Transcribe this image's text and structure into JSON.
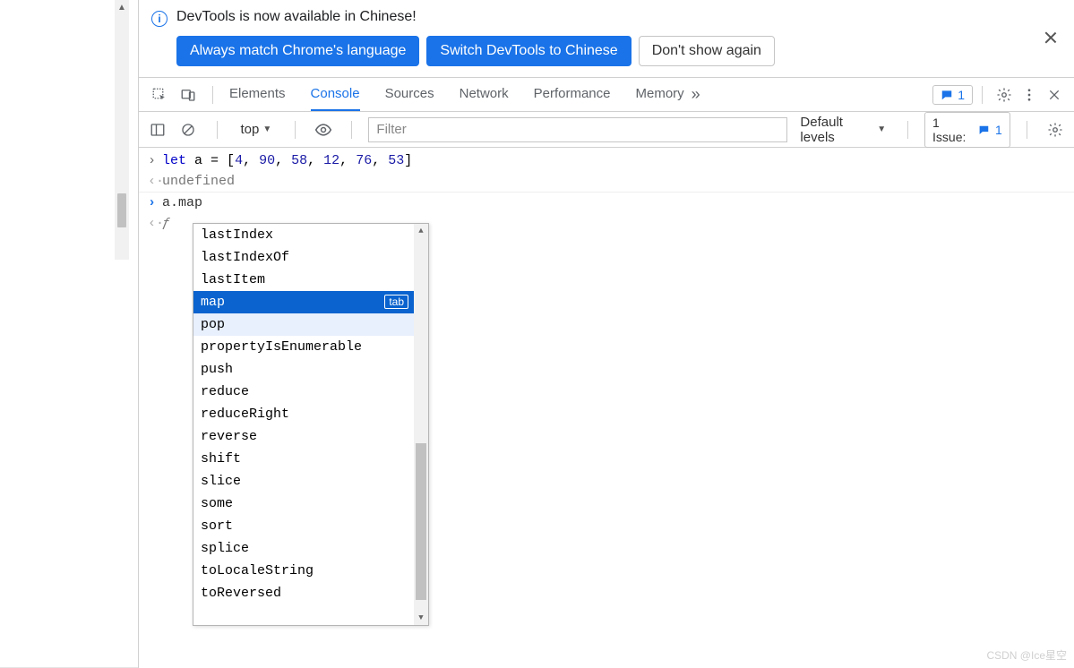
{
  "banner": {
    "message": "DevTools is now available in Chinese!",
    "btn_always": "Always match Chrome's language",
    "btn_switch": "Switch DevTools to Chinese",
    "btn_dismiss": "Don't show again"
  },
  "tabs": {
    "items": [
      "Elements",
      "Console",
      "Sources",
      "Network",
      "Performance",
      "Memory"
    ],
    "active": "Console",
    "messages_count": "1"
  },
  "filterbar": {
    "context": "top",
    "placeholder": "Filter",
    "levels": "Default levels",
    "issues_label": "1 Issue:",
    "issues_count": "1"
  },
  "console": {
    "input1_tokens": [
      "let",
      " a ",
      "=",
      " [",
      "4",
      ", ",
      "90",
      ", ",
      "58",
      ", ",
      "12",
      ", ",
      "76",
      ", ",
      "53",
      "]"
    ],
    "output1": "undefined",
    "input2": "a.map",
    "fn_marker": "ƒ"
  },
  "autocomplete": {
    "items": [
      {
        "label": "lastIndex",
        "state": ""
      },
      {
        "label": "lastIndexOf",
        "state": ""
      },
      {
        "label": "lastItem",
        "state": ""
      },
      {
        "label": "map",
        "state": "sel"
      },
      {
        "label": "pop",
        "state": "hov"
      },
      {
        "label": "propertyIsEnumerable",
        "state": ""
      },
      {
        "label": "push",
        "state": ""
      },
      {
        "label": "reduce",
        "state": ""
      },
      {
        "label": "reduceRight",
        "state": ""
      },
      {
        "label": "reverse",
        "state": ""
      },
      {
        "label": "shift",
        "state": ""
      },
      {
        "label": "slice",
        "state": ""
      },
      {
        "label": "some",
        "state": ""
      },
      {
        "label": "sort",
        "state": ""
      },
      {
        "label": "splice",
        "state": ""
      },
      {
        "label": "toLocaleString",
        "state": ""
      },
      {
        "label": "toReversed",
        "state": ""
      }
    ],
    "tab_hint": "tab"
  },
  "watermark": "CSDN @Ice星空"
}
